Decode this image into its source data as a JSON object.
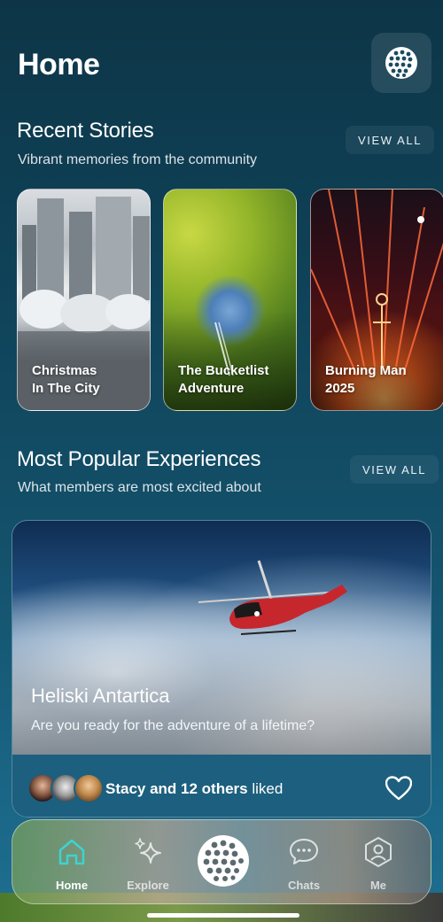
{
  "header": {
    "title": "Home",
    "globe_icon": "golf-ball-icon"
  },
  "recent_stories": {
    "title": "Recent Stories",
    "subtitle": "Vibrant memories from the community",
    "view_all": "VIEW ALL",
    "items": [
      {
        "label": "Christmas\nIn The City"
      },
      {
        "label": "The Bucketlist\nAdventure"
      },
      {
        "label": "Burning Man\n2025"
      }
    ]
  },
  "popular": {
    "title": "Most Popular Experiences",
    "subtitle": "What members are most excited about",
    "view_all": "VIEW ALL",
    "card": {
      "title": "Heliski Antartica",
      "subtitle": "Are you ready for the adventure of a lifetime?",
      "liked_name": "Stacy and 12 others",
      "liked_suffix": " liked"
    }
  },
  "nav": {
    "home": "Home",
    "explore": "Explore",
    "chats": "Chats",
    "me": "Me"
  },
  "colors": {
    "accent": "#3fd2d0",
    "background": "#0f4258"
  }
}
